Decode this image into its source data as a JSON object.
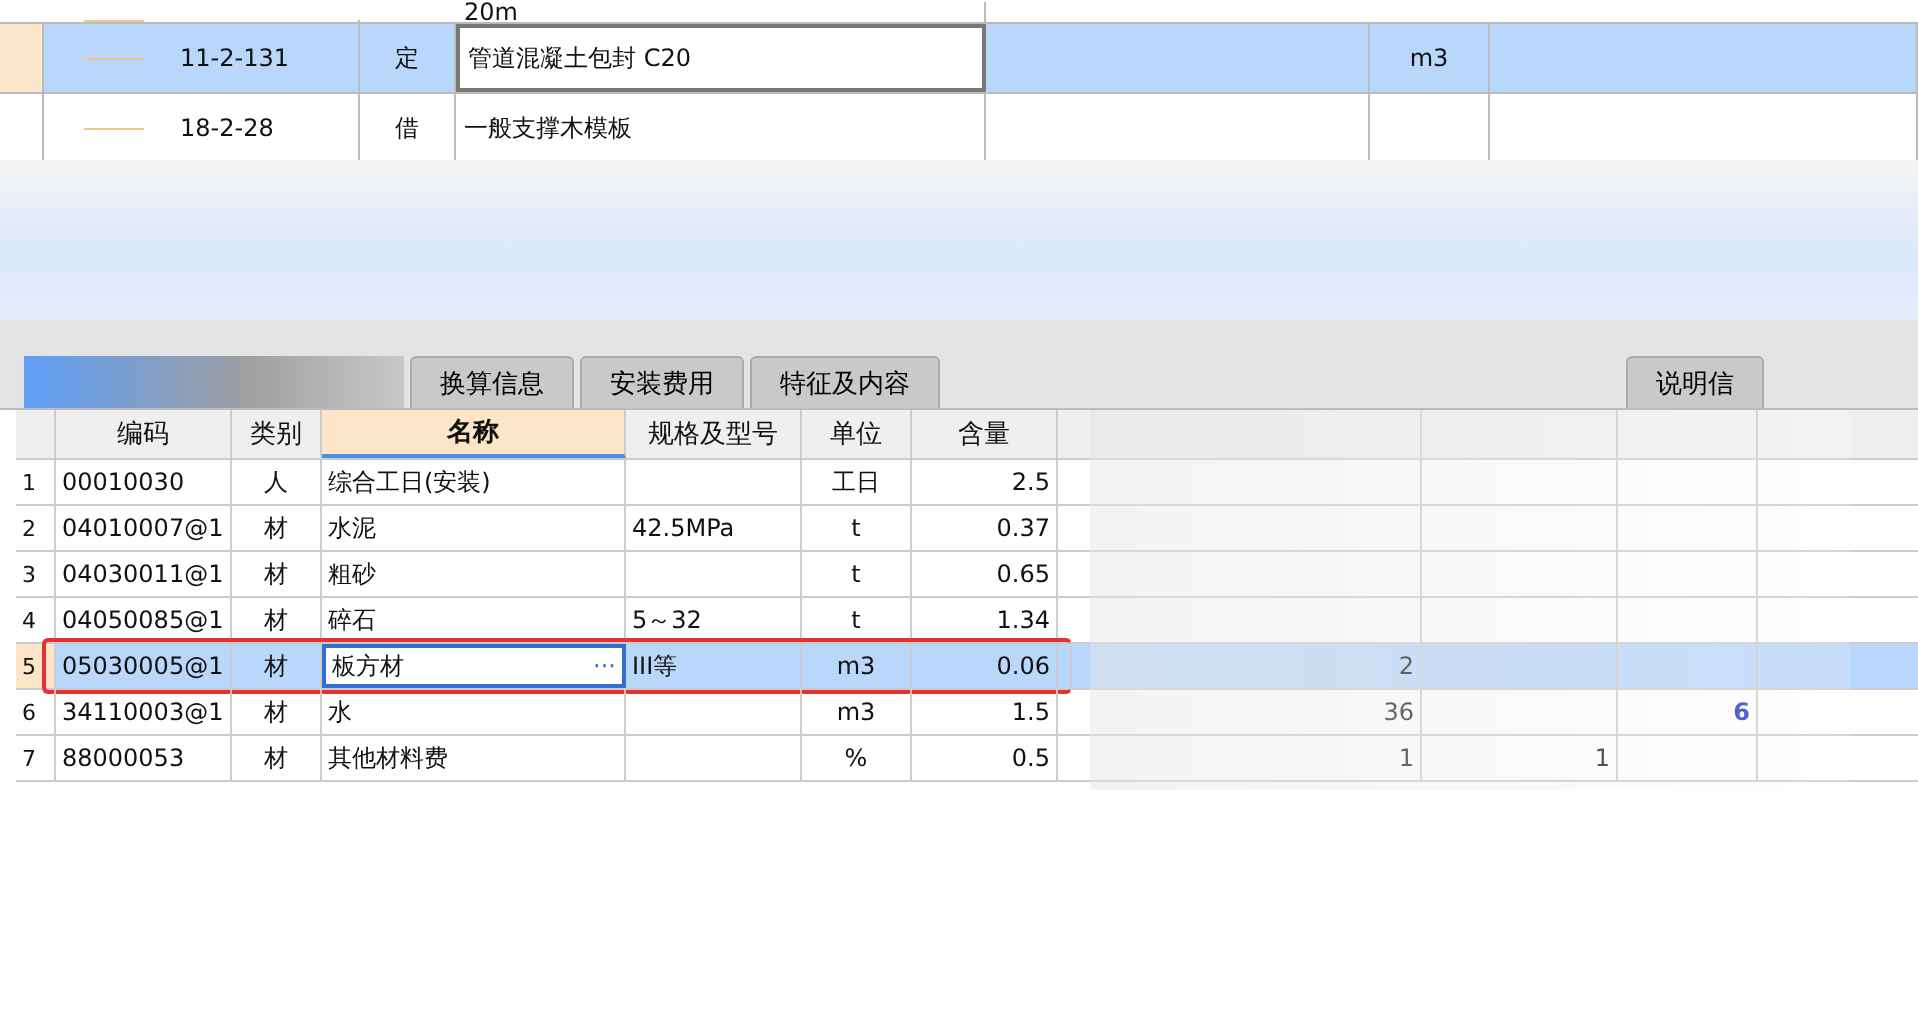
{
  "upper_grid": {
    "rows": [
      {
        "code": "",
        "type": "",
        "name": "20m",
        "unit": "",
        "selected": false,
        "partial": true
      },
      {
        "code": "11-2-131",
        "type": "定",
        "name": "管道混凝土包封 C20",
        "unit": "m3",
        "selected": true,
        "partial": false
      },
      {
        "code": "18-2-28",
        "type": "借",
        "name": "一般支撑木模板",
        "unit": "",
        "selected": false,
        "partial": false
      }
    ]
  },
  "tabs": [
    {
      "label": "换算信息",
      "selected": false
    },
    {
      "label": "安装费用",
      "selected": false
    },
    {
      "label": "特征及内容",
      "selected": false
    },
    {
      "label": "说明信",
      "selected": false
    }
  ],
  "lower_grid": {
    "columns": [
      "编码",
      "类别",
      "名称",
      "规格及型号",
      "单位",
      "含量"
    ],
    "ellipsis": "···",
    "rows": [
      {
        "index": "1",
        "code": "00010030",
        "type": "人",
        "name": "综合工日(安装)",
        "spec": "",
        "unit": "工日",
        "qty": "2.5",
        "column_7": "",
        "column_8": "",
        "column_9": "",
        "selected": false,
        "highlighted": false
      },
      {
        "index": "2",
        "code": "04010007@1",
        "type": "材",
        "name": "水泥",
        "spec": "42.5MPa",
        "unit": "t",
        "qty": "0.37",
        "column_7": "",
        "column_8": "",
        "column_9": "",
        "selected": false,
        "highlighted": false
      },
      {
        "index": "3",
        "code": "04030011@1",
        "type": "材",
        "name": "粗砂",
        "spec": "",
        "unit": "t",
        "qty": "0.65",
        "column_7": "",
        "column_8": "",
        "column_9": "",
        "selected": false,
        "highlighted": false
      },
      {
        "index": "4",
        "code": "04050085@1",
        "type": "材",
        "name": "碎石",
        "spec": "5～32",
        "unit": "t",
        "qty": "1.34",
        "column_7": "",
        "column_8": "",
        "column_9": "",
        "selected": false,
        "highlighted": false
      },
      {
        "index": "5",
        "code": "05030005@1",
        "type": "材",
        "name": "板方材",
        "spec": "III等",
        "unit": "m3",
        "qty": "0.06",
        "column_7": "2",
        "column_8": "",
        "column_9": "",
        "selected": true,
        "highlighted": true
      },
      {
        "index": "6",
        "code": "34110003@1",
        "type": "材",
        "name": "水",
        "spec": "",
        "unit": "m3",
        "qty": "1.5",
        "column_7": "36",
        "column_8": "",
        "column_9": "6",
        "selected": false,
        "highlighted": false
      },
      {
        "index": "7",
        "code": "88000053",
        "type": "材",
        "name": "其他材料费",
        "spec": "",
        "unit": "%",
        "qty": "0.5",
        "column_7": "1",
        "column_8": "1",
        "column_9": "",
        "selected": false,
        "highlighted": false
      }
    ]
  }
}
